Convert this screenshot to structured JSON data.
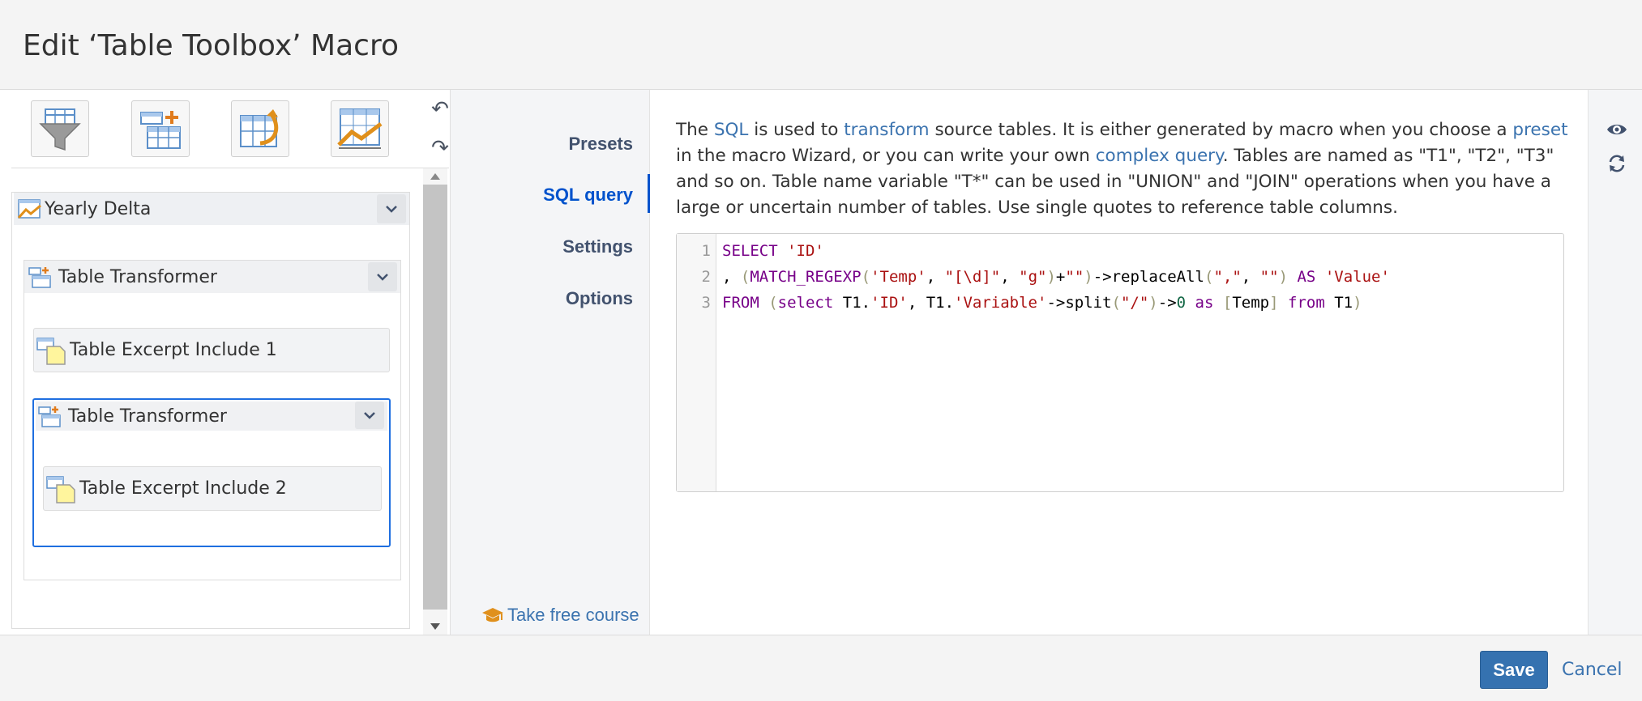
{
  "dialog": {
    "title": "Edit ‘Table Toolbox’ Macro"
  },
  "toolbar": {
    "tools": [
      "filter-table-icon",
      "add-table-icon",
      "pivot-table-icon",
      "chart-table-icon"
    ],
    "undo_icon": "undo-icon",
    "redo_icon": "redo-icon"
  },
  "tree": {
    "root": {
      "label": "Yearly Delta",
      "icon": "chart-icon"
    },
    "transformer1": {
      "label": "Table Transformer",
      "icon": "table-transformer-icon"
    },
    "include1": {
      "label": "Table Excerpt Include 1",
      "icon": "table-excerpt-icon"
    },
    "transformer2": {
      "label": "Table Transformer",
      "icon": "table-transformer-icon"
    },
    "include2": {
      "label": "Table Excerpt Include 2",
      "icon": "table-excerpt-icon"
    }
  },
  "nav": {
    "items": [
      "Presets",
      "SQL query",
      "Settings",
      "Options"
    ],
    "active": "SQL query",
    "course": "Take free course"
  },
  "description": {
    "p1": "The ",
    "link_sql": "SQL",
    "p2": " is used to ",
    "link_transform": "transform",
    "p3": " source tables. It is either generated by macro when you choose a ",
    "link_preset": "preset",
    "p4": " in the macro Wizard, or you can write your own ",
    "link_complex": "complex query",
    "p5": ". Tables are named as \"T1\", \"T2\", \"T3\" and so on. Table name variable \"T*\" can be used in \"UNION\" and \"JOIN\" operations when you have a large or uncertain number of tables. Use single quotes to reference table columns."
  },
  "editor": {
    "line_numbers": [
      "1",
      "2",
      "3"
    ],
    "lines": [
      "SELECT 'ID'",
      ", (MATCH_REGEXP('Temp', \"[\\d]\", \"g\")+\"\")->replaceAll(\",\", \"\") AS 'Value'",
      "FROM (select T1.'ID', T1.'Variable'->split(\"/\")->0 as [Temp] from T1)"
    ]
  },
  "right_icons": [
    "eye-icon",
    "refresh-icon"
  ],
  "footer": {
    "save": "Save",
    "cancel": "Cancel"
  }
}
